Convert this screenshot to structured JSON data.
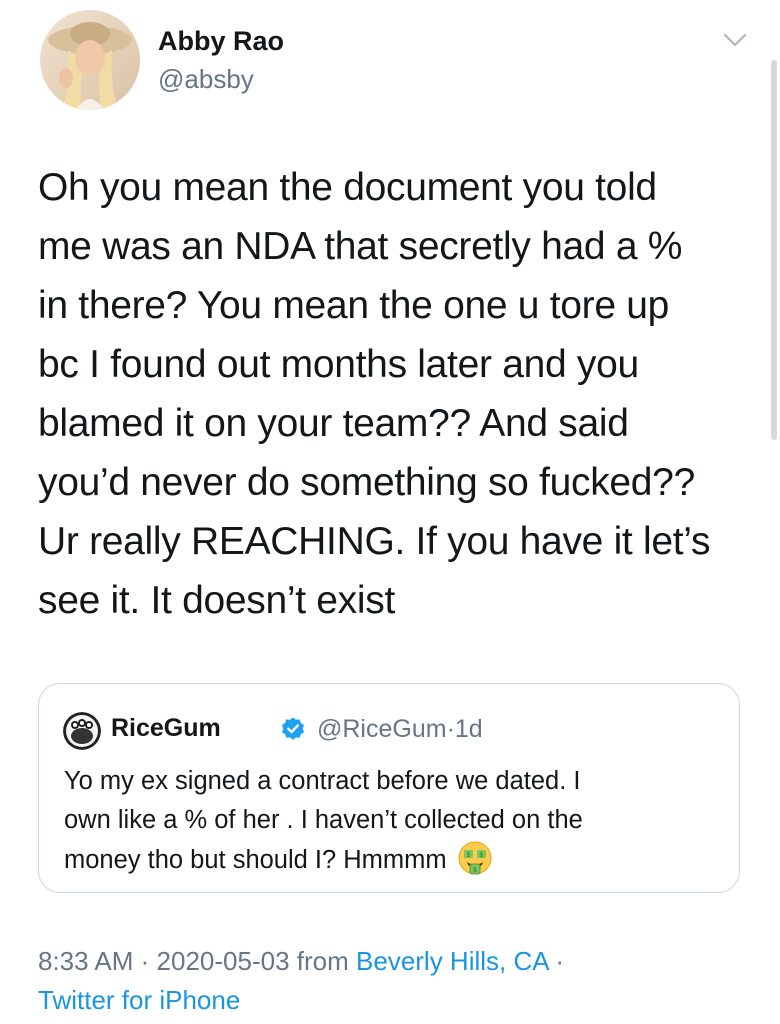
{
  "author": {
    "name": "Abby Rao",
    "handle": "@absby"
  },
  "tweet": {
    "lines": [
      "Oh you mean the document you told",
      "me was an NDA that secretly had a %",
      "in there? You mean the one u tore up",
      "bc I found out months later and you",
      "blamed it on your team?? And said",
      "you’d never do something so fucked??",
      "Ur really REACHING. If you have it let’s",
      "see it. It doesn’t exist"
    ]
  },
  "quoted": {
    "name": "RiceGum",
    "handle": "@RiceGum",
    "separator": "·",
    "time": "1d",
    "lines": [
      "Yo my ex signed a contract before we dated. I",
      "own like a % of her . I haven’t collected on the",
      "money tho but should I? Hmmmm"
    ],
    "emoji": "money-mouth-face-icon"
  },
  "meta": {
    "time": "8:33 AM",
    "separator": "·",
    "date": "2020-05-03",
    "from_label": "from",
    "location": "Beverly Hills, CA",
    "separator2": "·",
    "source": "Twitter for iPhone"
  },
  "colors": {
    "text": "#14171a",
    "secondary": "#657786",
    "link": "#1b95e0",
    "verified": "#1da1f2",
    "border": "#ccd6dd"
  }
}
